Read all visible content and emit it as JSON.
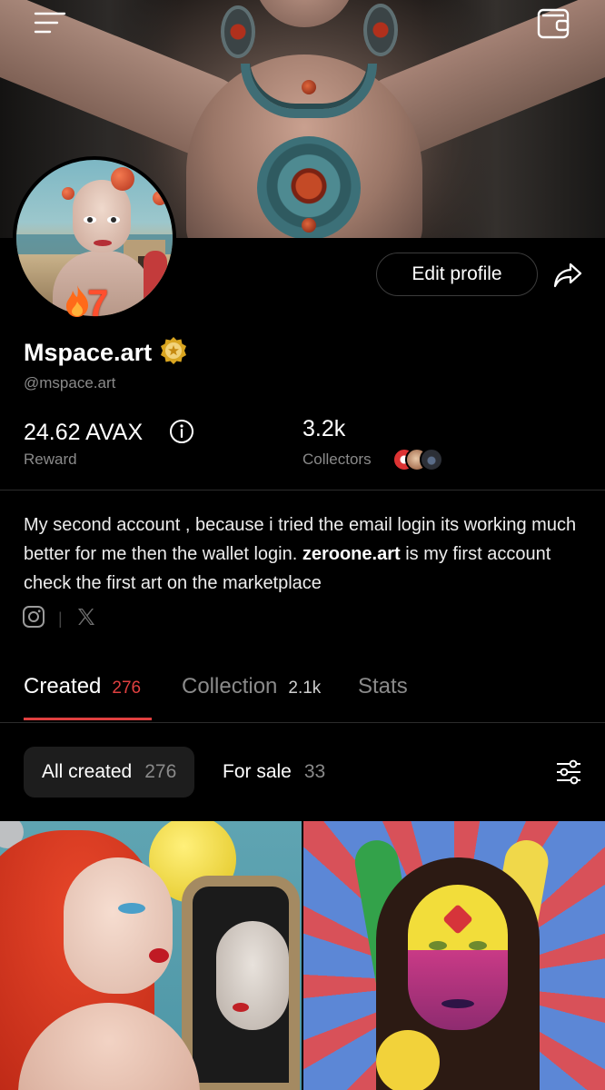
{
  "profile": {
    "display_name": "Mspace.art",
    "handle": "@mspace.art",
    "streak_count": "7",
    "edit_profile_label": "Edit profile"
  },
  "stats": {
    "reward_value": "24.62 AVAX",
    "reward_label": "Reward",
    "collectors_value": "3.2k",
    "collectors_label": "Collectors"
  },
  "bio": {
    "text": "My second account , because i tried the email login its working much better for me then the wallet login.",
    "link_text": "zeroone.art",
    "text_after": "is my first account check the first art on the marketplace"
  },
  "tabs": [
    {
      "label": "Created",
      "count": "276",
      "active": true
    },
    {
      "label": "Collection",
      "count": "2.1k",
      "active": false
    },
    {
      "label": "Stats",
      "count": "",
      "active": false
    }
  ],
  "filters": [
    {
      "label": "All created",
      "count": "276",
      "active": true
    },
    {
      "label": "For sale",
      "count": "33",
      "active": false
    }
  ],
  "icons": {
    "menu": "menu-icon",
    "wallet": "wallet-icon",
    "share": "share-icon",
    "info": "info-icon",
    "instagram": "instagram-icon",
    "x": "x-icon",
    "filter_settings": "sliders-icon",
    "verified": "verified-badge-icon",
    "streak": "flame-icon"
  },
  "colors": {
    "background": "#000000",
    "accent": "#e04040",
    "muted_text": "#8a8a8a",
    "pill_bg": "#1d1d1d",
    "verified_gold": "#d9a520"
  }
}
